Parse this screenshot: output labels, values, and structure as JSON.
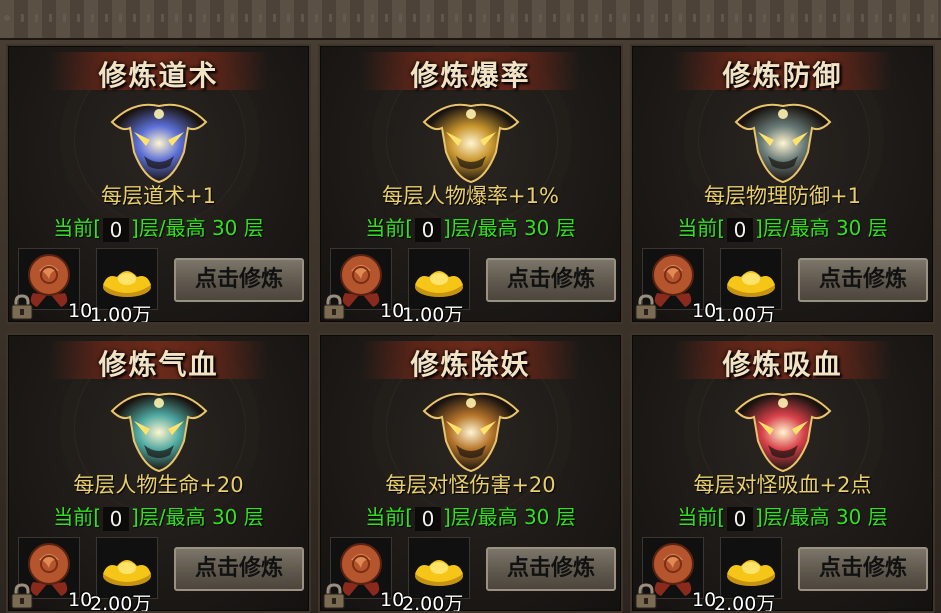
{
  "colors": {
    "title_text": "#f1e3c4",
    "desc_text": "#e9cf6c",
    "layer_text": "#31e11e",
    "button_bg": "#6a6357"
  },
  "cards": [
    {
      "title": "修炼道术",
      "desc": "每层道术+1",
      "layer_prefix": "当前[",
      "layer_value": "0",
      "layer_suffix": "]层/最高",
      "max_value": "30",
      "max_unit": "层",
      "item_count": "10",
      "cost": "1.00万",
      "button": "点击修炼",
      "emblem_icon": "blue-demon-helmet-icon",
      "emblem_color": "#5b6fd6"
    },
    {
      "title": "修炼爆率",
      "desc": "每层人物爆率+1%",
      "layer_prefix": "当前[",
      "layer_value": "0",
      "layer_suffix": "]层/最高",
      "max_value": "30",
      "max_unit": "层",
      "item_count": "10",
      "cost": "1.00万",
      "button": "点击修炼",
      "emblem_icon": "golden-winged-mask-icon",
      "emblem_color": "#c9962e"
    },
    {
      "title": "修炼防御",
      "desc": "每层物理防御+1",
      "layer_prefix": "当前[",
      "layer_value": "0",
      "layer_suffix": "]层/最高",
      "max_value": "30",
      "max_unit": "层",
      "item_count": "10",
      "cost": "1.00万",
      "button": "点击修炼",
      "emblem_icon": "dark-wolf-mask-icon",
      "emblem_color": "#6b7d7a"
    },
    {
      "title": "修炼气血",
      "desc": "每层人物生命+20",
      "layer_prefix": "当前[",
      "layer_value": "0",
      "layer_suffix": "]层/最高",
      "max_value": "30",
      "max_unit": "层",
      "item_count": "10",
      "cost": "2.00万",
      "button": "点击修炼",
      "emblem_icon": "jade-dragon-mask-icon",
      "emblem_color": "#4fa9a1"
    },
    {
      "title": "修炼除妖",
      "desc": "每层对怪伤害+20",
      "layer_prefix": "当前[",
      "layer_value": "0",
      "layer_suffix": "]层/最高",
      "max_value": "30",
      "max_unit": "层",
      "item_count": "10",
      "cost": "2.00万",
      "button": "点击修炼",
      "emblem_icon": "bronze-beast-mask-icon",
      "emblem_color": "#b5742a"
    },
    {
      "title": "修炼吸血",
      "desc": "每层对怪吸血+2点",
      "layer_prefix": "当前[",
      "layer_value": "0",
      "layer_suffix": "]层/最高",
      "max_value": "30",
      "max_unit": "层",
      "item_count": "10",
      "cost": "2.00万",
      "button": "点击修炼",
      "emblem_icon": "crimson-demon-mask-icon",
      "emblem_color": "#d8414a"
    }
  ],
  "icons": {
    "material": "bronze-orb-material-icon",
    "currency": "gold-ingot-icon",
    "lock": "lock-icon"
  }
}
